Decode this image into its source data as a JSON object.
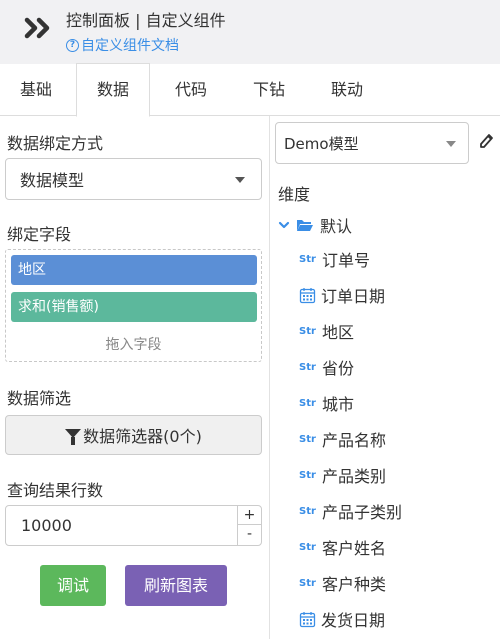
{
  "header": {
    "title": "控制面板 | 自定义组件",
    "doc_link": "自定义组件文档"
  },
  "tabs": [
    {
      "label": "基础"
    },
    {
      "label": "数据",
      "active": true
    },
    {
      "label": "代码"
    },
    {
      "label": "下钻"
    },
    {
      "label": "联动"
    }
  ],
  "left": {
    "binding_mode_label": "数据绑定方式",
    "binding_mode_value": "数据模型",
    "bind_fields_label": "绑定字段",
    "bound_fields": [
      {
        "label": "地区",
        "color": "#5b8fd6"
      },
      {
        "label": "求和(销售额)",
        "color": "#5cb89c"
      }
    ],
    "drop_hint": "拖入字段",
    "filter_label": "数据筛选",
    "filter_button": "数据筛选器(0个)",
    "rows_label": "查询结果行数",
    "rows_value": "10000",
    "stepper_up": "+",
    "stepper_down": "-",
    "debug_button": "调试",
    "refresh_button": "刷新图表"
  },
  "right": {
    "model_select": "Demo模型",
    "dimension_label": "维度",
    "folder": "默认",
    "fields": [
      {
        "type": "Str",
        "label": "订单号"
      },
      {
        "type": "date",
        "label": "订单日期"
      },
      {
        "type": "Str",
        "label": "地区"
      },
      {
        "type": "Str",
        "label": "省份"
      },
      {
        "type": "Str",
        "label": "城市"
      },
      {
        "type": "Str",
        "label": "产品名称"
      },
      {
        "type": "Str",
        "label": "产品类别"
      },
      {
        "type": "Str",
        "label": "产品子类别"
      },
      {
        "type": "Str",
        "label": "客户姓名"
      },
      {
        "type": "Str",
        "label": "客户种类"
      },
      {
        "type": "date",
        "label": "发货日期"
      }
    ]
  },
  "colors": {
    "accent_blue": "#3a8ee6",
    "debug_green": "#5cb85c",
    "refresh_purple": "#7a61b4"
  }
}
